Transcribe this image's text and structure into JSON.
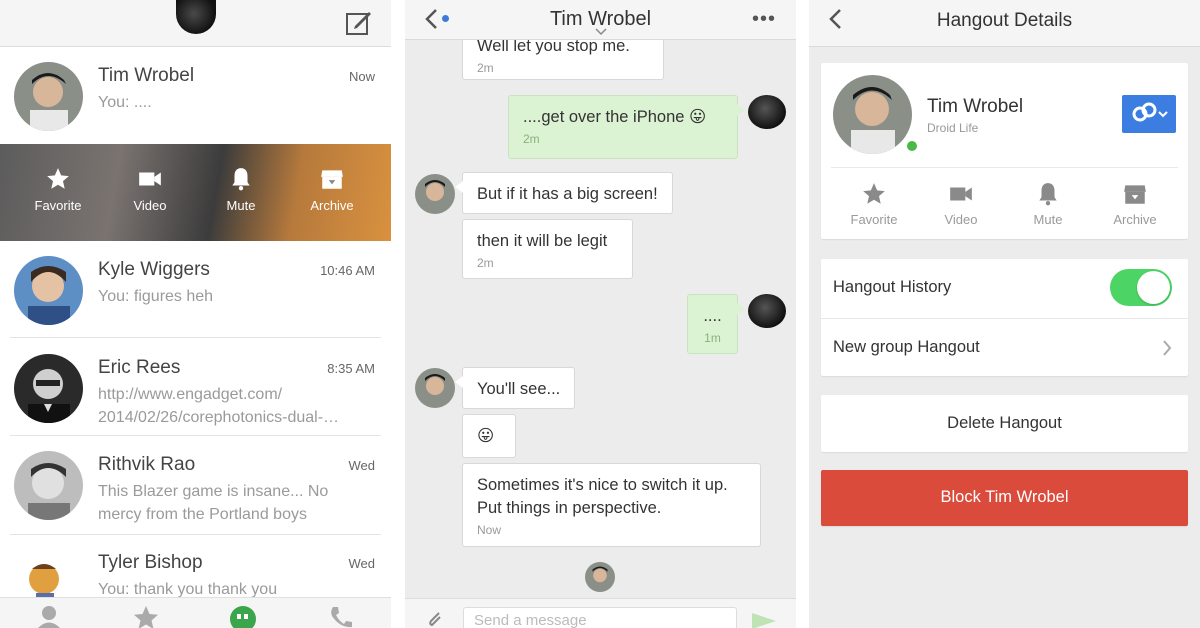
{
  "conversations_screen": {
    "conversations": [
      {
        "name": "Tim Wrobel",
        "time": "Now",
        "snippet": "You: ...."
      },
      {
        "name": "Kyle Wiggers",
        "time": "10:46 AM",
        "snippet": "You: figures heh"
      },
      {
        "name": "Eric Rees",
        "time": "8:35 AM",
        "snippet": "http://www.engadget.com/ 2014/02/26/corephotonics-dual-…"
      },
      {
        "name": "Rithvik Rao",
        "time": "Wed",
        "snippet": "This Blazer game is insane... No mercy from the Portland boys"
      },
      {
        "name": "Tyler Bishop",
        "time": "Wed",
        "snippet": "You: thank you thank you"
      }
    ],
    "swipe_actions": [
      "Favorite",
      "Video",
      "Mute",
      "Archive"
    ]
  },
  "chat_screen": {
    "title": "Tim Wrobel",
    "messages": [
      {
        "from": "them",
        "text": "Well let you stop me.",
        "time": "2m"
      },
      {
        "from": "me",
        "text": "....get over the iPhone 😛",
        "time": "2m"
      },
      {
        "from": "them",
        "text": "But if it has a big screen!",
        "time": ""
      },
      {
        "from": "them",
        "text": "then it will be legit",
        "time": "2m"
      },
      {
        "from": "me",
        "text": "....",
        "time": "1m"
      },
      {
        "from": "them",
        "text": "You'll see...",
        "time": ""
      },
      {
        "from": "them",
        "text": "😛",
        "time": ""
      },
      {
        "from": "them",
        "text": "Sometimes it's nice to switch it up. Put things in perspective.",
        "time": "Now"
      }
    ],
    "input_placeholder": "Send a message"
  },
  "details_screen": {
    "title": "Hangout Details",
    "contact_name": "Tim Wrobel",
    "contact_subtitle": "Droid Life",
    "actions": [
      "Favorite",
      "Video",
      "Mute",
      "Archive"
    ],
    "history_label": "Hangout History",
    "history_enabled": true,
    "new_group_label": "New group Hangout",
    "delete_label": "Delete Hangout",
    "block_label": "Block Tim Wrobel"
  },
  "colors": {
    "accent_blue": "#3b7de0",
    "toggle_green": "#4cd564",
    "block_red": "#db4b3b",
    "my_bubble": "#dcf3d3"
  }
}
